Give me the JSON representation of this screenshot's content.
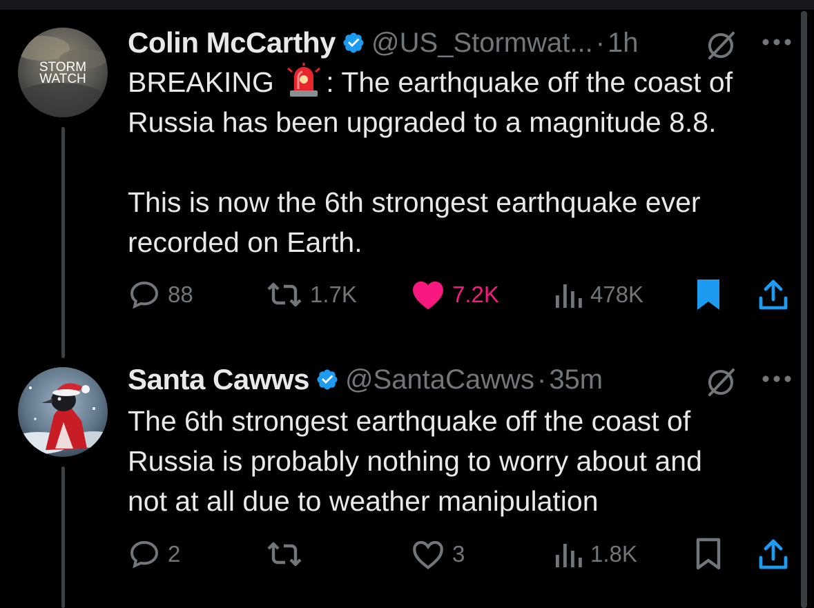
{
  "colors": {
    "background": "#000000",
    "text": "#e7e9ea",
    "muted": "#71767b",
    "verified": "#1d9bf0",
    "like": "#f91880",
    "bookmark": "#1d9bf0"
  },
  "tweets": [
    {
      "avatar_label": "STORM WATCH",
      "name": "Colin McCarthy",
      "handle": "@US_Stormwat...",
      "dot": "·",
      "time": "1h",
      "text_line1_a": "BREAKING ",
      "text_line1_b": ": The earthquake off the coast of",
      "text_line2": "Russia has been upgraded to a magnitude 8.8.",
      "text_line3": "This is now the 6th strongest earthquake ever",
      "text_line4": "recorded on Earth.",
      "icons": [
        "verified-badge-icon",
        "grok-icon",
        "more-icon",
        "siren-emoji"
      ],
      "actions": {
        "replies": "88",
        "reposts": "1.7K",
        "likes": "7.2K",
        "views": "478K",
        "liked": true,
        "bookmarked": true
      }
    },
    {
      "name": "Santa Cawws",
      "handle": "@SantaCawws",
      "dot": "·",
      "time": "35m",
      "text_line1": "The 6th strongest earthquake off the coast of",
      "text_line2": "Russia is probably nothing to worry about and",
      "text_line3": "not at all due to weather manipulation",
      "icons": [
        "verified-badge-icon",
        "grok-icon",
        "more-icon"
      ],
      "actions": {
        "replies": "2",
        "reposts": "",
        "likes": "3",
        "views": "1.8K",
        "liked": false,
        "bookmarked": false
      }
    }
  ]
}
